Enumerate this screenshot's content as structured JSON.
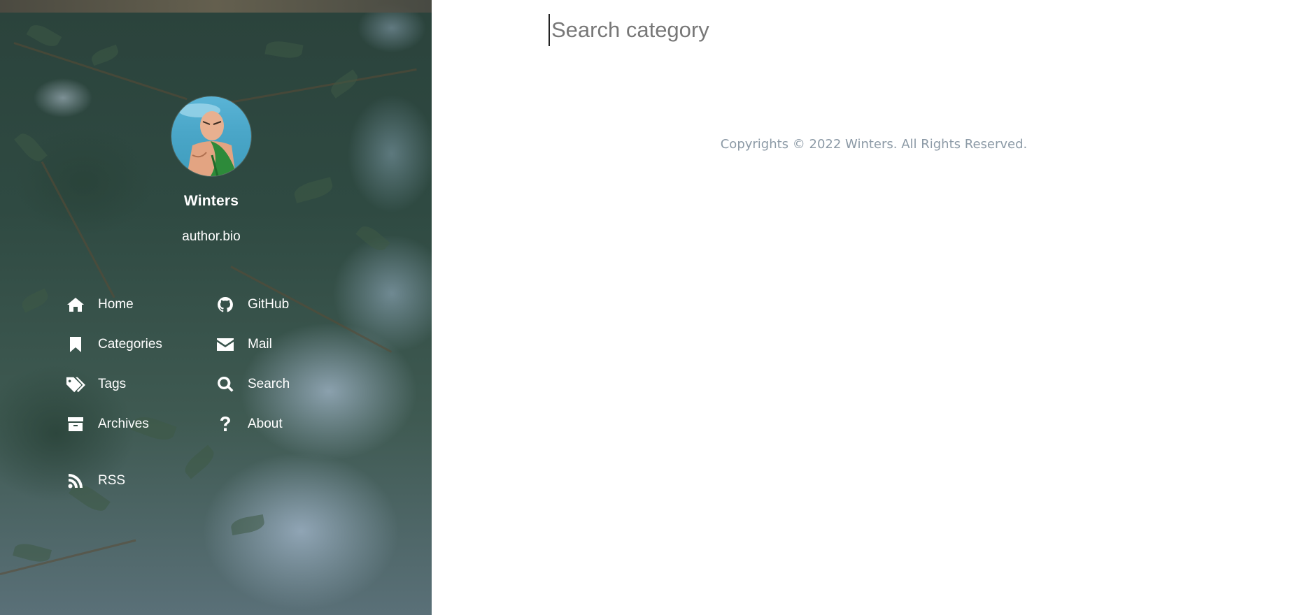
{
  "profile": {
    "name": "Winters",
    "bio": "author.bio"
  },
  "nav": {
    "home": "Home",
    "categories": "Categories",
    "tags": "Tags",
    "archives": "Archives",
    "github": "GitHub",
    "mail": "Mail",
    "search": "Search",
    "about": "About",
    "rss": "RSS"
  },
  "icons": {
    "home": "home-icon",
    "categories": "bookmark-icon",
    "tags": "tags-icon",
    "archives": "archive-icon",
    "github": "github-icon",
    "mail": "envelope-icon",
    "search": "search-icon",
    "about": "question-icon",
    "rss": "rss-icon"
  },
  "search": {
    "placeholder": "Search category",
    "value": ""
  },
  "footer": {
    "copyright": "Copyrights © 2022 Winters. All Rights Reserved."
  },
  "colors": {
    "sidebar_text": "#ffffff",
    "footer_text": "#8c9aa6",
    "placeholder": "#777777",
    "background": "#ffffff"
  }
}
